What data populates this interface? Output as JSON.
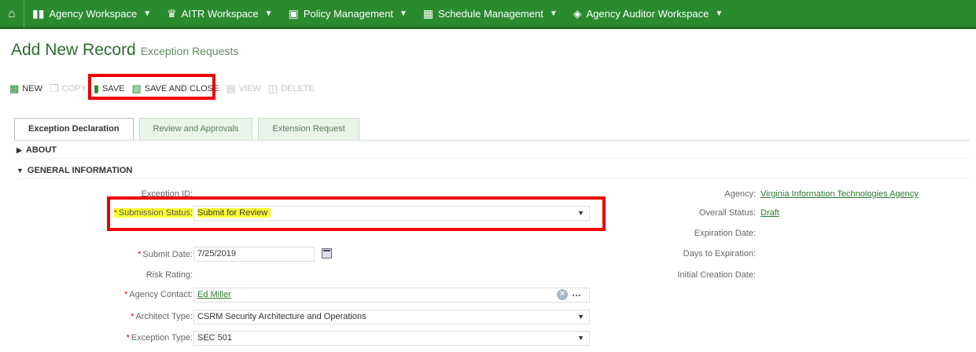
{
  "nav": {
    "home_icon": "home-icon",
    "items": [
      {
        "label": "Agency Workspace",
        "icon": "bar-chart-icon"
      },
      {
        "label": "AITR Workspace",
        "icon": "crown-icon"
      },
      {
        "label": "Policy Management",
        "icon": "briefcase-icon"
      },
      {
        "label": "Schedule Management",
        "icon": "calendar-icon"
      },
      {
        "label": "Agency Auditor Workspace",
        "icon": "layers-icon"
      }
    ],
    "bg_color": "#2a8a2e"
  },
  "page": {
    "title": "Add New Record",
    "subtitle": "Exception Requests"
  },
  "toolbar": {
    "new": "NEW",
    "copy": "COPY",
    "save": "SAVE",
    "save_close": "SAVE AND CLOSE",
    "view": "VIEW",
    "delete": "DELETE"
  },
  "tabs": [
    "Exception Declaration",
    "Review and Approvals",
    "Extension Request"
  ],
  "sections": {
    "about": "ABOUT",
    "general": "GENERAL INFORMATION"
  },
  "form": {
    "exception_id_label": "Exception ID:",
    "submission_status_label": "Submission Status:",
    "submission_status_value": "Submit for Review",
    "submit_date_label": "Submit Date:",
    "submit_date_value": "7/25/2019",
    "risk_rating_label": "Risk Rating:",
    "agency_contact_label": "Agency Contact:",
    "agency_contact_value": "Ed Miller",
    "architect_type_label": "Architect Type:",
    "architect_type_value": "CSRM Security Architecture and Operations",
    "exception_type_label": "Exception Type:",
    "exception_type_value": "SEC 501"
  },
  "right": {
    "agency_label": "Agency:",
    "agency_value": "Virginia Information Technologies Agency",
    "overall_status_label": "Overall Status:",
    "overall_status_value": "Draft",
    "expiration_date_label": "Expiration Date:",
    "days_to_expiration_label": "Days to Expiration:",
    "initial_creation_label": "Initial Creation Date:"
  },
  "colors": {
    "highlight_border": "#e00000",
    "highlight_fill": "#ffff33",
    "accent": "#2a8a2e"
  }
}
